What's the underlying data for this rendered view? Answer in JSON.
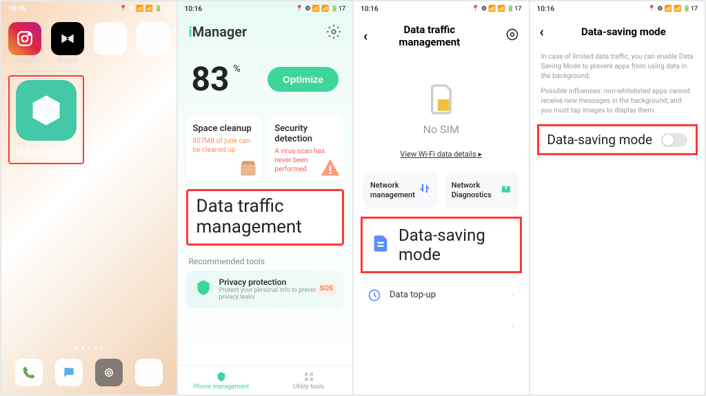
{
  "status": {
    "time": "10:16",
    "indicators": "📍 ⚙ 📶 📶 🔋17"
  },
  "home": {
    "apps": {
      "instagram": "Instagram",
      "capcut": "CapCut"
    },
    "imanager": "iManager"
  },
  "imanager": {
    "title_i": "i",
    "title_rest": "Manager",
    "score": "83",
    "score_unit": "%",
    "optimize": "Optimize",
    "cards": {
      "cleanup": {
        "title": "Space cleanup",
        "sub": "857MB of junk can be cleaned up"
      },
      "security": {
        "title": "Security detection",
        "sub": "A virus scan has never been performed"
      }
    },
    "data_traffic": "Data traffic management",
    "rec_title": "Recommended tools",
    "privacy": {
      "title": "Privacy protection",
      "sub": "Protect your personal info to prevent privacy leaks"
    },
    "sos": "SOS",
    "tabs": {
      "phone": "Phone management",
      "utility": "Utility tools"
    }
  },
  "dtm": {
    "title": "Data traffic management",
    "no_sim": "No SIM",
    "wifi_link": "View Wi-Fi data details ▸",
    "net_mgmt": "Network management",
    "net_diag": "Network Diagnostics",
    "dsm": "Data-saving mode",
    "topup": "Data top-up"
  },
  "dsm": {
    "title": "Data-saving mode",
    "info1": "In case of limited data traffic, you can enable Data Saving Mode to prevent apps from using data in the background.",
    "info2": "Possible influences: non-whitelisted apps cannot receive new messages in the background, and you must tap images to display them.",
    "toggle_label": "Data-saving mode"
  }
}
